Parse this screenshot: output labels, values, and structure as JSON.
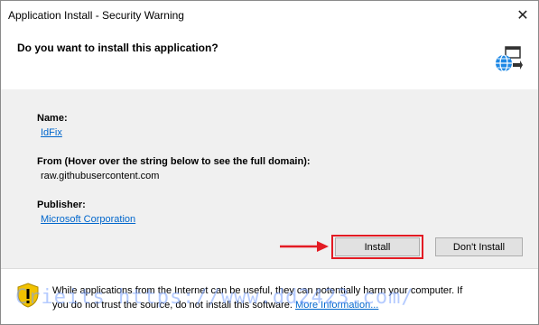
{
  "window": {
    "title": "Application Install - Security Warning",
    "close_glyph": "✕"
  },
  "header": {
    "question": "Do you want to install this application?",
    "icon": "application-install-icon"
  },
  "details": {
    "name_label": "Name:",
    "name_value": "IdFix",
    "from_label": "From (Hover over the string below to see the full domain):",
    "from_value": "raw.githubusercontent.com",
    "publisher_label": "Publisher:",
    "publisher_value": "Microsoft Corporation"
  },
  "buttons": {
    "install": "Install",
    "dont_install": "Don't Install"
  },
  "annotation": {
    "highlight_color": "#e31b23"
  },
  "footer": {
    "line1": "While applications from the Internet can be useful, they can potentially harm your computer. If",
    "line2_prefix": "you do not trust the source, do not install this software.",
    "link": "More Information...",
    "icon": "shield-warning-icon"
  },
  "watermark": {
    "text": "Crieits https://www.dd2423.com/"
  }
}
